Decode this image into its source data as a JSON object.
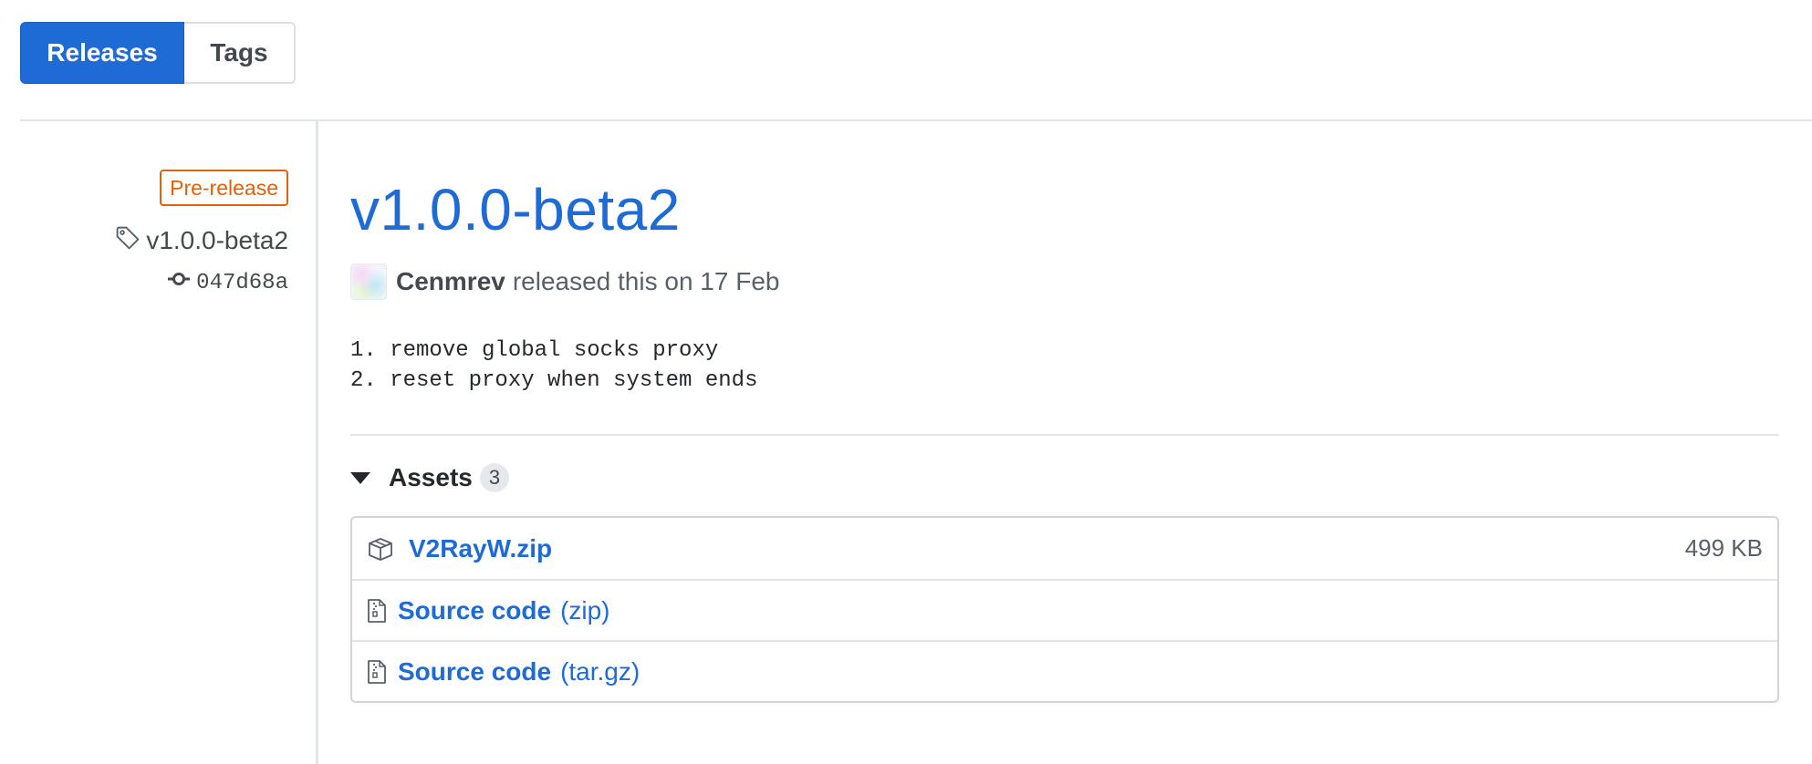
{
  "tabs": {
    "releases_label": "Releases",
    "tags_label": "Tags"
  },
  "meta": {
    "badge": "Pre-release",
    "tag": "v1.0.0-beta2",
    "commit": "047d68a"
  },
  "release": {
    "title": "v1.0.0-beta2",
    "author": "Cenmrev",
    "released_text": "released this on 17 Feb",
    "notes": [
      "1. remove global socks proxy",
      "2. reset proxy when system ends"
    ]
  },
  "assets": {
    "title": "Assets",
    "count": "3",
    "items": [
      {
        "name": "V2RayW.zip",
        "suffix": "",
        "size": "499 KB",
        "icon": "package-icon"
      },
      {
        "name": "Source code",
        "suffix": "(zip)",
        "size": "",
        "icon": "file-zip-icon"
      },
      {
        "name": "Source code",
        "suffix": "(tar.gz)",
        "size": "",
        "icon": "file-zip-icon"
      }
    ]
  },
  "colors": {
    "accent": "#1f6bd6",
    "prerelease": "#e36209"
  }
}
